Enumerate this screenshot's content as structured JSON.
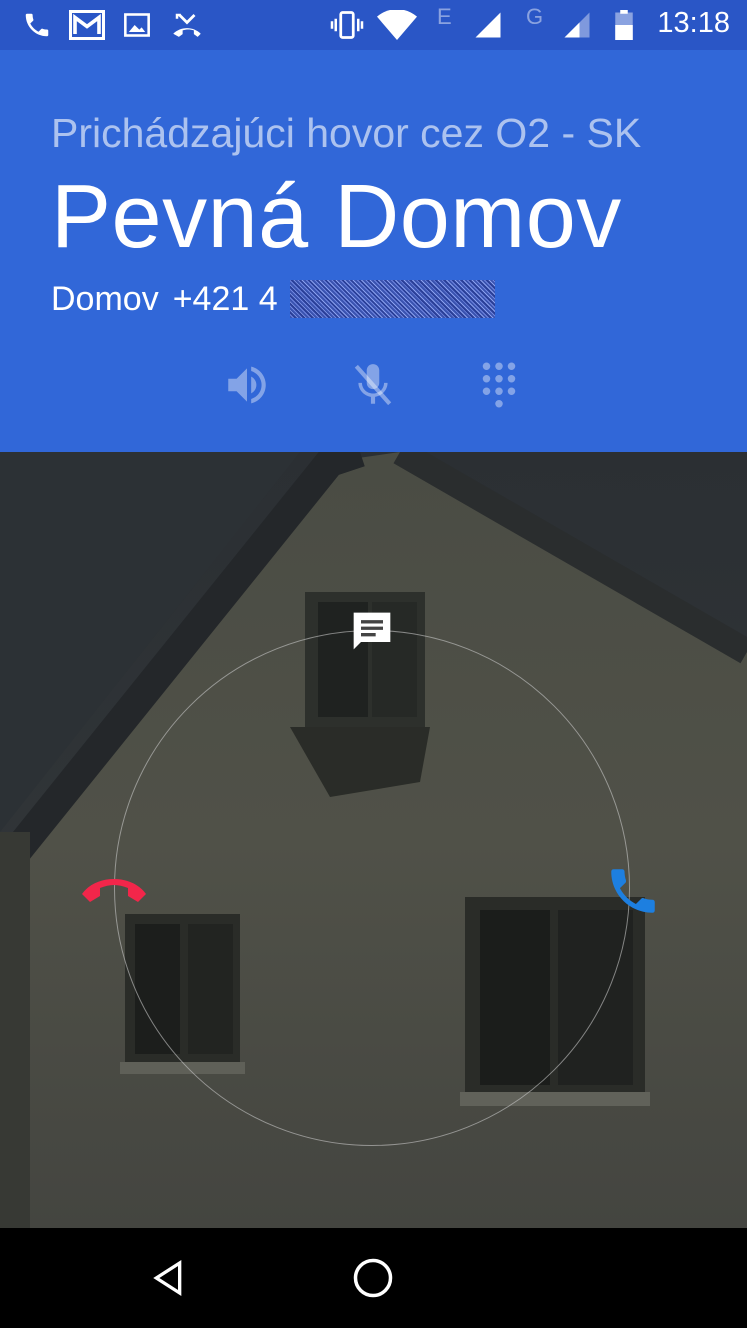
{
  "status_bar": {
    "time": "13:18",
    "network_e": "E",
    "network_g": "G",
    "icons": [
      "phone-icon",
      "gmail-icon",
      "gallery-icon",
      "missed-call-icon",
      "vibrate-icon",
      "wifi-icon",
      "signal-icon",
      "signal-icon",
      "battery-icon"
    ]
  },
  "call": {
    "incoming_via": "Prichádzajúci hovor cez O2 - SK",
    "caller_name": "Pevná Domov",
    "number_label": "Domov",
    "number": "+421 4"
  },
  "controls": [
    "speaker-icon",
    "mute-icon",
    "dialpad-icon"
  ],
  "actions": {
    "message": "message-icon",
    "decline": "decline-call-icon",
    "answer": "answer-call-icon"
  },
  "colors": {
    "header": "#3167d8",
    "status_bar": "#2a56c6",
    "decline": "#f2264a",
    "answer": "#1d7fe0"
  },
  "nav_bar": [
    "back-icon",
    "home-icon"
  ]
}
